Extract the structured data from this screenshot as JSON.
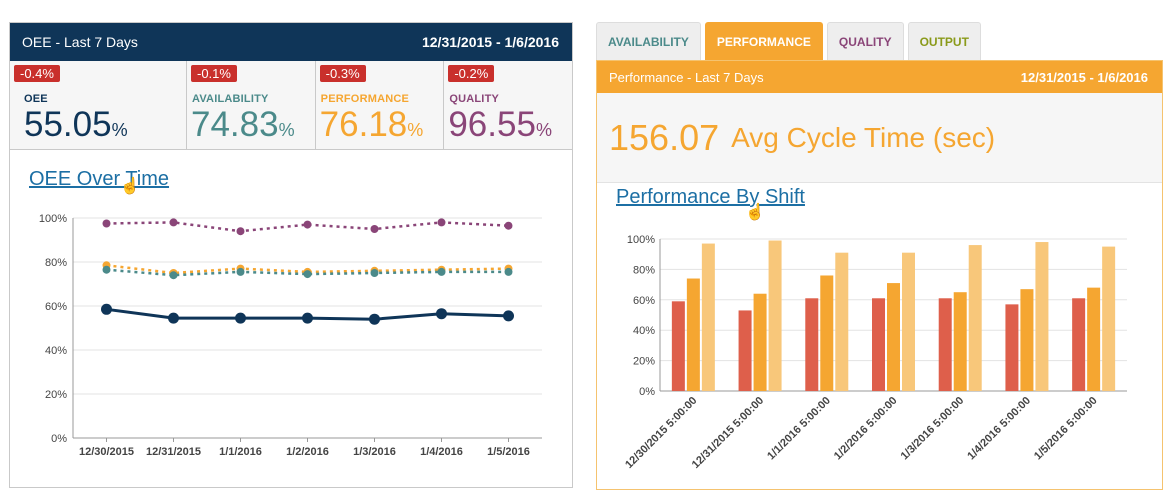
{
  "left": {
    "header_title": "OEE - Last 7 Days",
    "header_range": "12/31/2015 - 1/6/2016",
    "kpis": [
      {
        "delta": "-0.4%",
        "label": "OEE",
        "value": "55.05",
        "unit": "%"
      },
      {
        "delta": "-0.1%",
        "label": "AVAILABILITY",
        "value": "74.83",
        "unit": "%"
      },
      {
        "delta": "-0.3%",
        "label": "PERFORMANCE",
        "value": "76.18",
        "unit": "%"
      },
      {
        "delta": "-0.2%",
        "label": "QUALITY",
        "value": "96.55",
        "unit": "%"
      }
    ],
    "link_title": "OEE Over Time"
  },
  "right": {
    "tabs": [
      "AVAILABILITY",
      "PERFORMANCE",
      "QUALITY",
      "OUTPUT"
    ],
    "active_tab": "PERFORMANCE",
    "header_title": "Performance - Last 7 Days",
    "header_range": "12/31/2015 - 1/6/2016",
    "avg_value": "156.07",
    "avg_label": "Avg Cycle Time (sec)",
    "link_title": "Performance By Shift"
  },
  "colors": {
    "navy": "#0f3558",
    "teal": "#4b8a8a",
    "orange": "#f5a631",
    "purple": "#8a4578",
    "red_delta": "#c9302c",
    "bar_red": "#de5f4b",
    "bar_orange": "#f5a631",
    "bar_light": "#f8c77a"
  },
  "chart_data": [
    {
      "type": "line",
      "title": "OEE Over Time",
      "categories": [
        "12/30/2015",
        "12/31/2015",
        "1/1/2016",
        "1/2/2016",
        "1/3/2016",
        "1/4/2016",
        "1/5/2016"
      ],
      "ylim": [
        0,
        100
      ],
      "yticks": [
        "0%",
        "20%",
        "40%",
        "60%",
        "80%",
        "100%"
      ],
      "grid": true,
      "series": [
        {
          "color": "#8a4578",
          "dashed": true,
          "values": [
            97.5,
            98,
            94,
            97,
            95,
            98,
            96.5
          ]
        },
        {
          "color": "#f5a631",
          "dashed": true,
          "values": [
            78.5,
            75,
            77,
            75.5,
            76,
            76.5,
            77
          ]
        },
        {
          "color": "#4b8a8a",
          "dashed": true,
          "values": [
            76.5,
            74,
            75.5,
            74.5,
            75,
            75.5,
            75.5
          ]
        },
        {
          "color": "#0f3558",
          "dashed": false,
          "values": [
            58.5,
            54.5,
            54.5,
            54.5,
            54,
            56.5,
            55.5
          ]
        }
      ]
    },
    {
      "type": "bar",
      "title": "Performance By Shift",
      "categories": [
        "12/30/2015 5:00:00",
        "12/31/2015 5:00:00",
        "1/1/2016 5:00:00",
        "1/2/2016 5:00:00",
        "1/3/2016 5:00:00",
        "1/4/2016 5:00:00",
        "1/5/2016 5:00:00"
      ],
      "ylim": [
        0,
        100
      ],
      "yticks": [
        "0%",
        "20%",
        "40%",
        "60%",
        "80%",
        "100%"
      ],
      "grid": true,
      "series": [
        {
          "color": "#de5f4b",
          "values": [
            59,
            53,
            61,
            61,
            61,
            57,
            61
          ]
        },
        {
          "color": "#f5a631",
          "values": [
            74,
            64,
            76,
            71,
            65,
            67,
            68
          ]
        },
        {
          "color": "#f8c77a",
          "values": [
            97,
            99,
            91,
            91,
            96,
            98,
            95
          ]
        }
      ]
    }
  ]
}
